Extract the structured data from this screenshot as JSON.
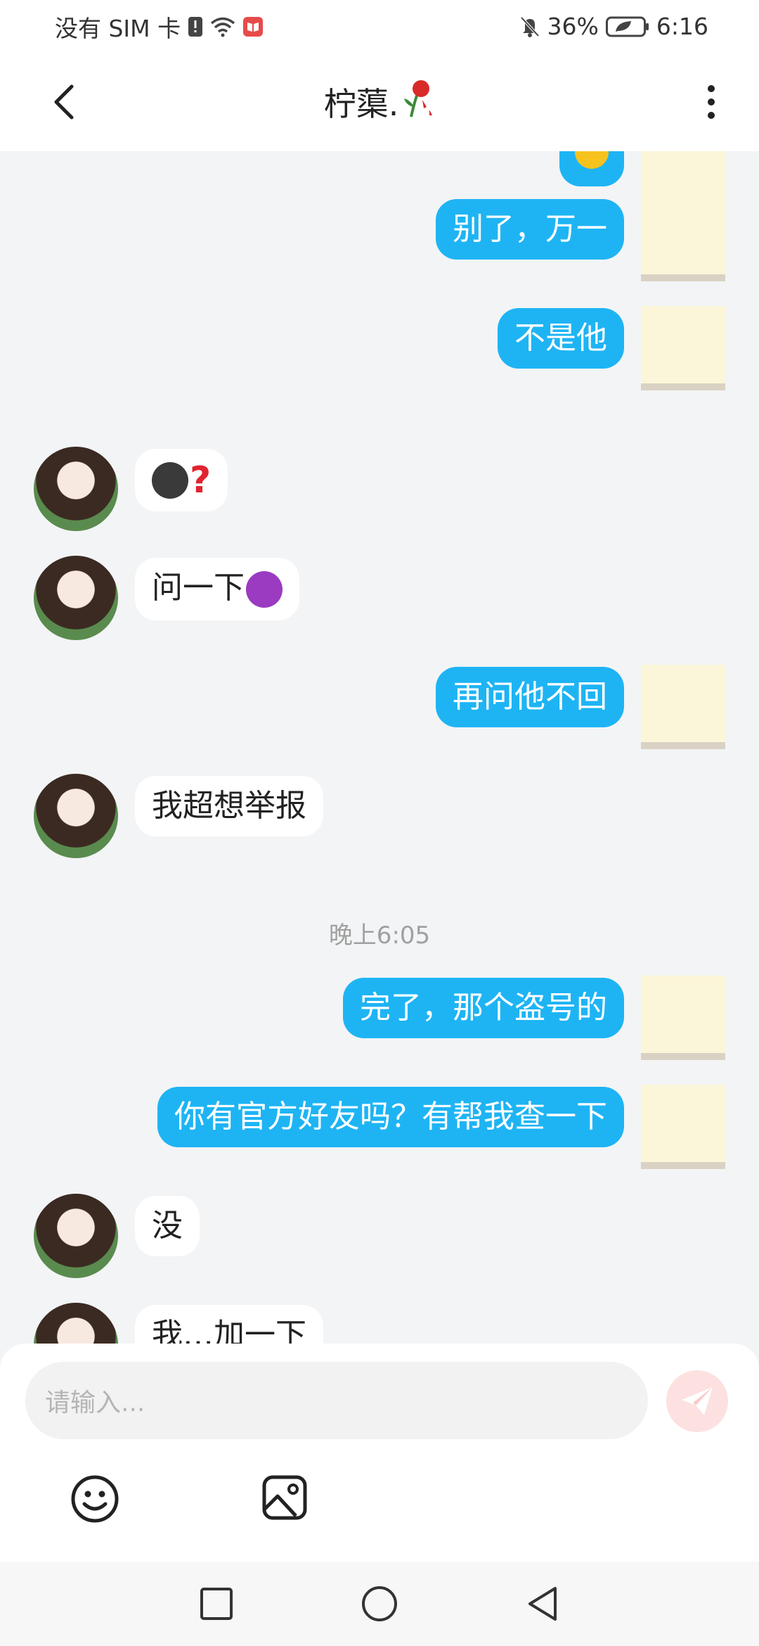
{
  "status_bar": {
    "carrier": "没有 SIM 卡",
    "battery": "36%",
    "time": "6:16"
  },
  "header": {
    "title": "柠蕖."
  },
  "messages": [
    {
      "side": "right",
      "text": "别了，万一"
    },
    {
      "side": "right",
      "text": "不是他"
    },
    {
      "side": "left",
      "text": "",
      "emoji": "smirk-dark-face + red-question-mark"
    },
    {
      "side": "left",
      "text": "问一下",
      "emoji": "angry-devil-face"
    },
    {
      "side": "right",
      "text": "再问他不回"
    },
    {
      "side": "left",
      "text": "我超想举报"
    },
    {
      "side": "right",
      "text": "完了，那个盗号的"
    },
    {
      "side": "right",
      "text": "你有官方好友吗？有帮我查一下"
    },
    {
      "side": "left",
      "text": "没"
    },
    {
      "side": "left",
      "text": "我…加一下"
    }
  ],
  "timestamp": "晚上6:05",
  "input": {
    "placeholder": "请输入..."
  },
  "colors": {
    "outgoing_bubble": "#1eb4f4",
    "incoming_bubble": "#ffffff",
    "chat_background": "#f3f4f6",
    "send_button_disabled": "#fde0e0"
  },
  "icons": {
    "back": "chevron-left-icon",
    "more": "vertical-dots-icon",
    "send": "paper-plane-icon",
    "emoji": "smiley-icon",
    "image": "image-icon",
    "nav_recents": "square-icon",
    "nav_home": "circle-icon",
    "nav_back": "triangle-back-icon"
  }
}
